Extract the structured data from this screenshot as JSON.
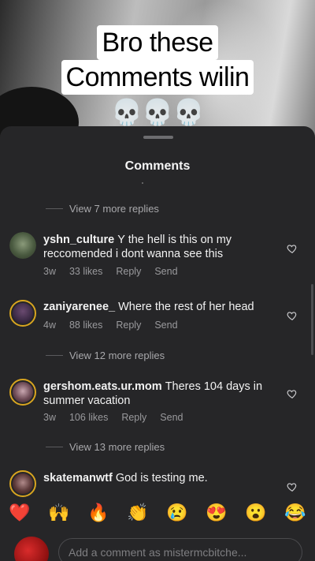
{
  "caption": {
    "line1": "Bro these",
    "line2": "Comments wilin",
    "emojis": "💀💀💀"
  },
  "sheet": {
    "title": "Comments"
  },
  "view_more": [
    "View 7 more replies",
    "View 12 more replies",
    "View 13 more replies"
  ],
  "comments": [
    {
      "username": "yshn_culture",
      "text": "Y the hell is this on my reccomended i dont wanna see this",
      "time": "3w",
      "likes": "33 likes",
      "reply": "Reply",
      "send": "Send"
    },
    {
      "username": "zaniyarenee_",
      "text": "Where the rest of her head",
      "time": "4w",
      "likes": "88 likes",
      "reply": "Reply",
      "send": "Send"
    },
    {
      "username": "gershom.eats.ur.mom",
      "text": "Theres 104 days in summer vacation",
      "time": "3w",
      "likes": "106 likes",
      "reply": "Reply",
      "send": "Send"
    },
    {
      "username": "skatemanwtf",
      "text": "God is testing me."
    }
  ],
  "emoji_bar": [
    "❤️",
    "🙌",
    "🔥",
    "👏",
    "😢",
    "😍",
    "😮",
    "😂"
  ],
  "input": {
    "placeholder": "Add a comment as mistermcbitche..."
  },
  "colors": {
    "sheet_bg": "#262628",
    "muted_text": "#9a9a9d",
    "story_ring": "#d8a520"
  }
}
